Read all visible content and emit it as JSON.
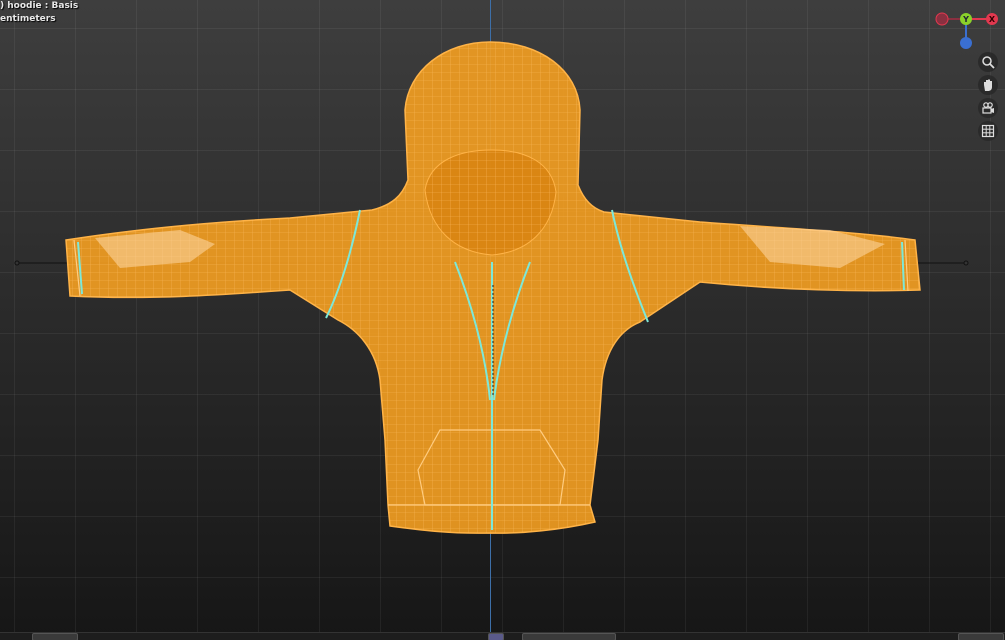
{
  "viewport": {
    "object_text": ") hoodie : Basis",
    "units_text": "entimeters"
  },
  "gizmo": {
    "axes": [
      {
        "label": "Y",
        "color": "#8bd12a"
      },
      {
        "label": "X",
        "color": "#e2384f"
      }
    ],
    "z_color": "#3a6fd1"
  },
  "nav_icons": [
    "zoom-icon",
    "pan-hand-icon",
    "camera-icon",
    "grid-icon"
  ],
  "colors": {
    "mesh_fill": "#f5a021",
    "mesh_wire": "#ffb347",
    "seam": "#7de8d8"
  }
}
